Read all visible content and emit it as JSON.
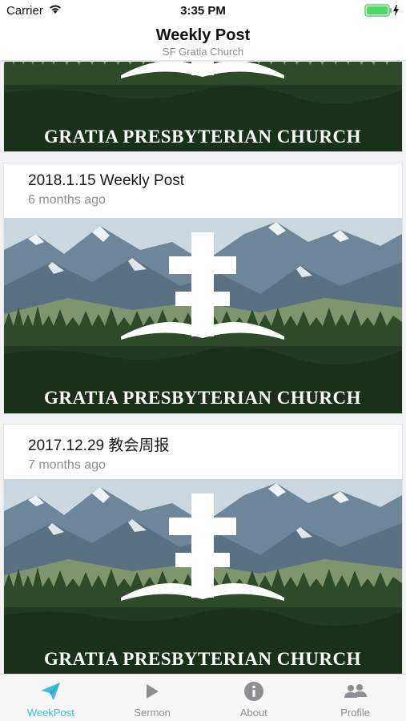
{
  "status_bar": {
    "carrier": "Carrier",
    "time": "3:35 PM"
  },
  "nav": {
    "title": "Weekly Post",
    "subtitle": "SF Gratia Church"
  },
  "banner_text": "GRATIA  PRESBYTERIAN   CHURCH",
  "posts": [
    {
      "title": "2018.1.15 Weekly Post",
      "time": "6 months ago"
    },
    {
      "title": "2017.12.29 教会周报",
      "time": "7 months ago"
    }
  ],
  "tabs": [
    {
      "label": "WeekPost",
      "icon": "paper-plane-icon",
      "active": true
    },
    {
      "label": "Sermon",
      "icon": "play-icon",
      "active": false
    },
    {
      "label": "About",
      "icon": "info-icon",
      "active": false
    },
    {
      "label": "Profile",
      "icon": "people-icon",
      "active": false
    }
  ],
  "colors": {
    "accent": "#35c2d6",
    "inactive": "#8e8e93"
  }
}
